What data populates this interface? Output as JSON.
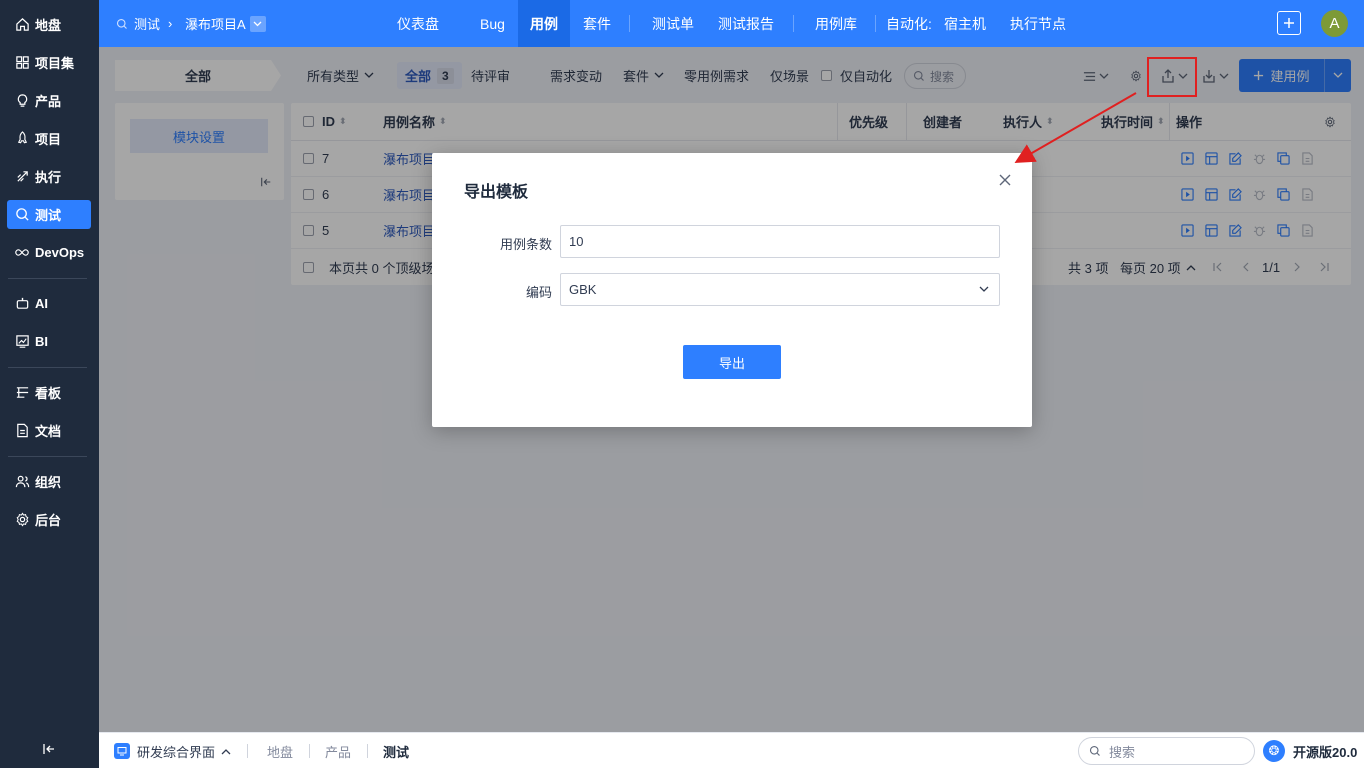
{
  "sidebar": {
    "items": [
      {
        "label": "地盘",
        "icon": "home-icon"
      },
      {
        "label": "项目集",
        "icon": "grid-icon"
      },
      {
        "label": "产品",
        "icon": "bulb-icon"
      },
      {
        "label": "项目",
        "icon": "rocket-icon"
      },
      {
        "label": "执行",
        "icon": "run-icon"
      },
      {
        "label": "测试",
        "icon": "search-icon"
      },
      {
        "label": "DevOps",
        "icon": "infinity-icon"
      },
      {
        "label": "AI",
        "icon": "robot-icon"
      },
      {
        "label": "BI",
        "icon": "chart-icon"
      },
      {
        "label": "看板",
        "icon": "kanban-icon"
      },
      {
        "label": "文档",
        "icon": "doc-icon"
      },
      {
        "label": "组织",
        "icon": "users-icon"
      },
      {
        "label": "后台",
        "icon": "gear-icon"
      }
    ],
    "active": "测试"
  },
  "topbar": {
    "module": "测试",
    "project": "瀑布项目A",
    "nav": [
      "仪表盘",
      "Bug",
      "用例",
      "套件",
      "测试单",
      "测试报告",
      "用例库",
      "自动化:",
      "宿主机",
      "执行节点"
    ],
    "active_nav": "用例",
    "avatar": "A"
  },
  "toolbar": {
    "all_tab": "全部",
    "type_filter": "所有类型",
    "filter_all": "全部",
    "filter_all_count": "3",
    "pending_review": "待评审",
    "req_change": "需求变动",
    "suite": "套件",
    "zero_case": "零用例需求",
    "scene_only": "仅场景",
    "auto_only": "仅自动化",
    "search": "搜索",
    "new_case": "建用例"
  },
  "module_panel": {
    "button": "模块设置"
  },
  "table": {
    "headers": {
      "id": "ID",
      "name": "用例名称",
      "priority": "优先级",
      "creator": "创建者",
      "executor": "执行人",
      "exec_time": "执行时间",
      "ops": "操作"
    },
    "rows": [
      {
        "id": "7",
        "name": "瀑布项目"
      },
      {
        "id": "6",
        "name": "瀑布项目"
      },
      {
        "id": "5",
        "name": "瀑布项目"
      }
    ],
    "footer_note": "本页共 0 个顶级场",
    "total": "共 3 项",
    "per_page": "每页 20 项",
    "page": "1/1"
  },
  "modal": {
    "title": "导出模板",
    "count_label": "用例条数",
    "count_value": "10",
    "encoding_label": "编码",
    "encoding_value": "GBK",
    "export_button": "导出"
  },
  "bottombar": {
    "app": "研发综合界面",
    "crumbs": [
      "地盘",
      "产品",
      "测试"
    ],
    "search": "搜索",
    "version": "开源版20.0"
  },
  "colors": {
    "brand": "#2e7fff",
    "sidebar_bg": "#1f2b3d",
    "annotation": "#e02020"
  }
}
